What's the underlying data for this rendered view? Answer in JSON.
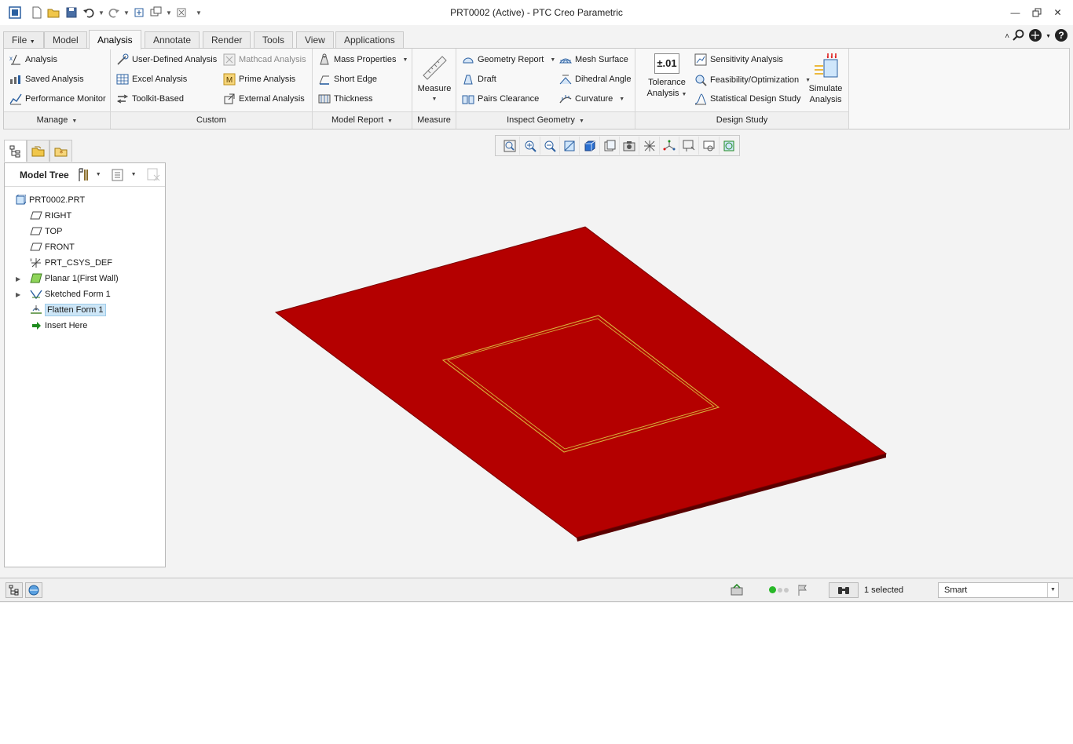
{
  "window": {
    "title": "PRT0002 (Active) - PTC Creo Parametric",
    "controls": [
      "minimize-icon",
      "restore-icon",
      "close-icon"
    ]
  },
  "quick_access": [
    "app-icon",
    "new-icon",
    "open-icon",
    "save-icon",
    "undo-icon",
    "redo-icon",
    "regenerate-icon",
    "windows-icon",
    "close-window-icon",
    "customize-icon"
  ],
  "tabs": [
    "File",
    "Model",
    "Analysis",
    "Annotate",
    "Render",
    "Tools",
    "View",
    "Applications"
  ],
  "active_tab": "Analysis",
  "ribbon": {
    "manage": {
      "label": "Manage",
      "items": [
        "Analysis",
        "Saved Analysis",
        "Performance Monitor"
      ]
    },
    "custom": {
      "label": "Custom",
      "col1": [
        "User-Defined Analysis",
        "Excel Analysis",
        "Toolkit-Based"
      ],
      "col2": [
        "Mathcad Analysis",
        "Prime Analysis",
        "External Analysis"
      ]
    },
    "model_report": {
      "label": "Model Report",
      "items": [
        "Mass Properties",
        "Short Edge",
        "Thickness"
      ]
    },
    "measure": {
      "label": "Measure",
      "button": "Measure"
    },
    "inspect_geometry": {
      "label": "Inspect Geometry",
      "col1": [
        "Geometry Report",
        "Draft",
        "Pairs Clearance"
      ],
      "col2": [
        "Mesh Surface",
        "Dihedral Angle",
        "Curvature"
      ],
      "tolerance_line1": "Tolerance",
      "tolerance_line2": "Analysis"
    },
    "design_study": {
      "label": "Design Study",
      "items": [
        "Sensitivity Analysis",
        "Feasibility/Optimization",
        "Statistical Design Study"
      ],
      "simulate_line1": "Simulate",
      "simulate_line2": "Analysis",
      "tolerance_badge": "±.01"
    }
  },
  "model_tree": {
    "title": "Model Tree",
    "nodes": [
      {
        "label": "PRT0002.PRT",
        "icon": "part-icon"
      },
      {
        "label": "RIGHT",
        "icon": "datum-plane-icon"
      },
      {
        "label": "TOP",
        "icon": "datum-plane-icon"
      },
      {
        "label": "FRONT",
        "icon": "datum-plane-icon"
      },
      {
        "label": "PRT_CSYS_DEF",
        "icon": "csys-icon"
      },
      {
        "label": "Planar 1(First Wall)",
        "icon": "planar-wall-icon"
      },
      {
        "label": "Sketched Form 1",
        "icon": "sketched-form-icon"
      },
      {
        "label": "Flatten Form 1",
        "icon": "flatten-form-icon"
      },
      {
        "label": "Insert Here",
        "icon": "insert-arrow-icon"
      }
    ]
  },
  "view_toolbar": [
    "refit-icon",
    "zoom-in-icon",
    "zoom-out-icon",
    "repaint-icon",
    "shading-icon",
    "saved-orientations-icon",
    "view-manager-icon",
    "datum-display-icon",
    "csys-display-icon",
    "spin-center-icon",
    "annotation-display-icon",
    "appearance-icon"
  ],
  "model": {
    "sheet_color": "#b40000",
    "edge_color": "#5a0000",
    "form_outline_color": "#d8b23a"
  },
  "status": {
    "selected": "1 selected",
    "filter": "Smart"
  }
}
